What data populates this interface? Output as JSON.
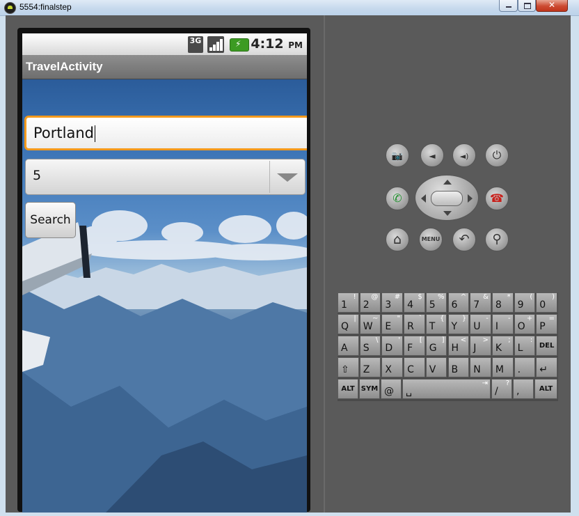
{
  "window": {
    "title": "5554:finalstep",
    "close_glyph": "✕"
  },
  "status_bar": {
    "network": "3G",
    "time": "4:12",
    "ampm": "PM"
  },
  "app": {
    "title": "TravelActivity"
  },
  "form": {
    "city_value": "Portland",
    "count_value": "5",
    "search_label": "Search"
  },
  "controls": {
    "menu_label": "MENU",
    "camera_icon": "📷",
    "vol_down_icon": "◄",
    "vol_up_icon": "◄)",
    "power_icon": "⏻",
    "call_icon": "✆",
    "end_call_icon": "☎",
    "home_icon": "⌂",
    "back_icon": "↶",
    "search_icon": "⚲"
  },
  "keyboard": {
    "rows": [
      [
        [
          "1",
          "!"
        ],
        [
          "2",
          "@"
        ],
        [
          "3",
          "#"
        ],
        [
          "4",
          "$"
        ],
        [
          "5",
          "%"
        ],
        [
          "6",
          "^"
        ],
        [
          "7",
          "&"
        ],
        [
          "8",
          "*"
        ],
        [
          "9",
          "("
        ],
        [
          "0",
          ")"
        ]
      ],
      [
        [
          "Q",
          "|"
        ],
        [
          "W",
          "~"
        ],
        [
          "E",
          "\""
        ],
        [
          "R",
          "`"
        ],
        [
          "T",
          "{"
        ],
        [
          "Y",
          "}"
        ],
        [
          "U",
          "-"
        ],
        [
          "I",
          "-"
        ],
        [
          "O",
          "+"
        ],
        [
          "P",
          "="
        ]
      ],
      [
        [
          "A",
          ""
        ],
        [
          "S",
          "\\"
        ],
        [
          "D",
          "'"
        ],
        [
          "F",
          "["
        ],
        [
          "G",
          "]"
        ],
        [
          "H",
          "<"
        ],
        [
          "J",
          ">"
        ],
        [
          "K",
          ";"
        ],
        [
          "L",
          ":"
        ],
        [
          "DEL",
          ""
        ]
      ],
      [
        [
          "⇧",
          ""
        ],
        [
          "Z",
          ""
        ],
        [
          "X",
          ""
        ],
        [
          "C",
          ""
        ],
        [
          "V",
          ""
        ],
        [
          "B",
          ""
        ],
        [
          "N",
          ""
        ],
        [
          "M",
          ""
        ],
        [
          ".",
          ""
        ],
        [
          "↵",
          ""
        ]
      ],
      [
        [
          "ALT",
          ""
        ],
        [
          "SYM",
          ""
        ],
        [
          "@",
          ""
        ],
        [
          "␣",
          "⇥"
        ],
        [
          "/",
          "?"
        ],
        [
          ",",
          ""
        ],
        [
          "ALT",
          ""
        ]
      ]
    ]
  }
}
